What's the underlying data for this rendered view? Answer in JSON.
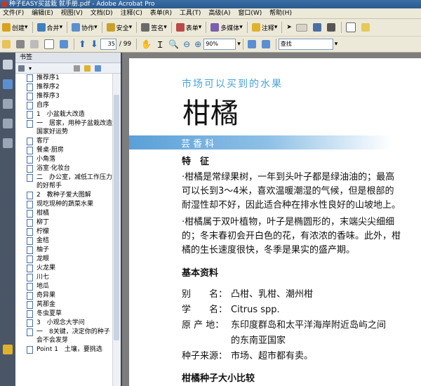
{
  "window": {
    "title": "种子EASY买盆栽 就手册.pdf - Adobe Acrobat Pro"
  },
  "menu": [
    "文件(F)",
    "编辑(E)",
    "视图(V)",
    "文档(D)",
    "注释(C)",
    "表单(R)",
    "工具(T)",
    "高级(A)",
    "窗口(W)",
    "帮助(H)"
  ],
  "toolbar1": {
    "buttons": [
      "创建",
      "合并",
      "协作",
      "安全",
      "签名",
      "表单",
      "多媒体",
      "注释"
    ],
    "colors": {
      "create": "#d9a21b",
      "combine": "#3f7fbf",
      "collab": "#5b8fd1",
      "security": "#c9a12a",
      "sign": "#6a6a6a",
      "form": "#b94a48",
      "media": "#7a5fb0",
      "comment": "#e0b12b"
    }
  },
  "toolbar2": {
    "current_page": "35",
    "total_pages": "/ 99",
    "zoom": "90%",
    "search_placeholder": "查找"
  },
  "panel": {
    "title": "书签",
    "bookmarks": [
      "推荐序1",
      "推荐序2",
      "推荐序3",
      "自序",
      "1　小盆栽大改造",
      "一　居家，用种子盆栽改造国家好运势",
      "客厅",
      "餐桌·厨房",
      "小角落",
      "浴室·化妆台",
      "二　办公室，减低工作压力的好帮手",
      "2　教种子爱大图解",
      "现吃现种的蔬菜水果",
      "柑橘",
      "柳丁",
      "柠檬",
      "金桔",
      "柚子",
      "龙眼",
      "火龙果",
      "川七",
      "地瓜",
      "奇异果",
      "莴那金",
      "冬虫夏草",
      "3　小观念大学问",
      "一　8关键，决定你的种子会不会发芽",
      "Point 1　土壤，要挑选"
    ]
  },
  "document": {
    "subtitle": "市场可以买到的水果",
    "title": "柑橘",
    "band_label": "芸香科",
    "section_feature": "特　征",
    "para1": [
      "·柑橘是常绿果树，一年到头叶子都是绿油油的；最高",
      "可以长到3～4米，喜欢温暖潮湿的气候，但是根部的",
      "耐湿性却不好，因此适合种在排水性良好的山坡地上。"
    ],
    "para2": [
      "·柑橘属于双叶植物，叶子是椭圆形的，末端尖尖细细",
      "的；冬末春初会开白色的花，有浓浓的香味。此外，柑",
      "橘的生长速度很快，冬季是果实的盛产期。"
    ],
    "section_basic": "基本资料",
    "info": [
      {
        "label": "别　　名：",
        "value": "凸柑、乳柑、潮州柑"
      },
      {
        "label": "学　　名：",
        "value": "Citrus spp."
      },
      {
        "label": "原 产 地：",
        "value": "东印度群岛和太平洋海岸附近岛屿之间"
      },
      {
        "label": "",
        "value": "的东南亚国家"
      },
      {
        "label": "种子来源：",
        "value": "市场、超市都有卖。"
      }
    ],
    "section_size": "柑橘种子大小比较"
  }
}
